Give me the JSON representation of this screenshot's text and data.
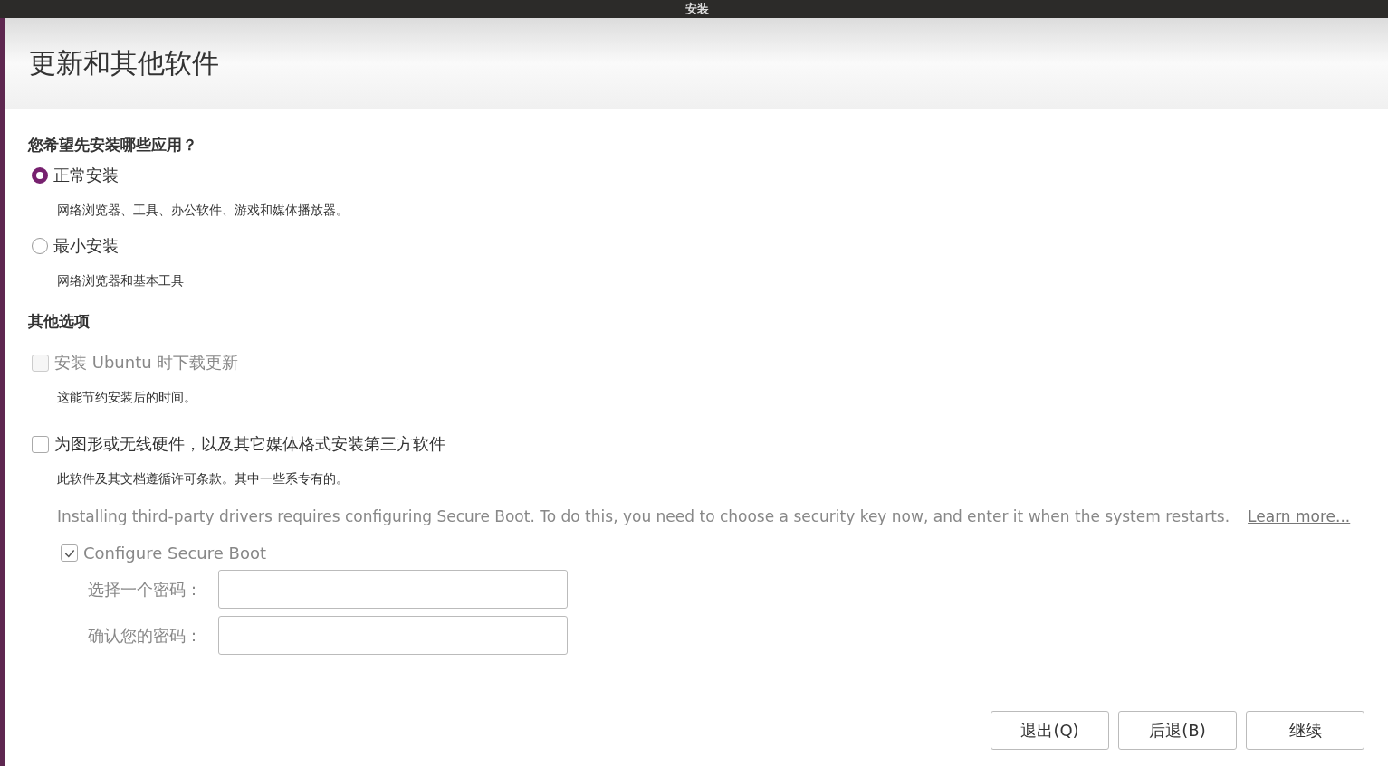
{
  "window": {
    "title": "安装"
  },
  "header": {
    "title": "更新和其他软件"
  },
  "install_question": "您希望先安装哪些应用？",
  "install_options": [
    {
      "label": "正常安装",
      "description": "网络浏览器、工具、办公软件、游戏和媒体播放器。",
      "selected": true
    },
    {
      "label": "最小安装",
      "description": "网络浏览器和基本工具",
      "selected": false
    }
  ],
  "other_heading": "其他选项",
  "other_options": [
    {
      "label": "安装 Ubuntu 时下载更新",
      "description": "这能节约安装后的时间。",
      "checked": false,
      "disabled": true
    },
    {
      "label": "为图形或无线硬件，以及其它媒体格式安装第三方软件",
      "description": "此软件及其文档遵循许可条款。其中一些系专有的。",
      "checked": false,
      "disabled": false
    }
  ],
  "secure_boot": {
    "note": "Installing third-party drivers requires configuring Secure Boot. To do this, you need to choose a security key now, and enter it when the system restarts.",
    "link": "Learn more...",
    "checkbox": {
      "label": "Configure Secure Boot",
      "checked": true
    },
    "fields": [
      {
        "label": "选择一个密码："
      },
      {
        "label": "确认您的密码："
      }
    ]
  },
  "buttons": [
    "退出(Q)",
    "后退(B)",
    "继续"
  ]
}
